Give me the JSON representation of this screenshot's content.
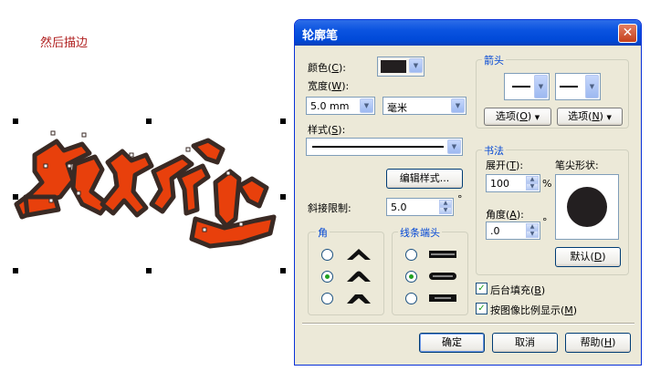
{
  "canvas": {
    "caption": "然后描边"
  },
  "dialog": {
    "title": "轮廓笔",
    "close_icon": "close-icon",
    "color": {
      "label_pre": "颜色(",
      "label_key": "C",
      "label_post": "):",
      "swatch": "#231f20"
    },
    "width": {
      "label_pre": "宽度(",
      "label_key": "W",
      "label_post": "):",
      "value": "5.0 mm",
      "unit": "毫米"
    },
    "style": {
      "label_pre": "样式(",
      "label_key": "S",
      "label_post": "):"
    },
    "edit_style_button": "编辑样式...",
    "miter": {
      "label": "斜接限制:",
      "value": "5.0",
      "unit": "°"
    },
    "corners": {
      "title": "角",
      "selected": 1
    },
    "linecaps": {
      "title": "线条端头",
      "selected": 1
    },
    "arrows": {
      "title": "箭头",
      "option_left": {
        "pre": "选项(",
        "key": "O",
        "post": ")"
      },
      "option_right": {
        "pre": "选项(",
        "key": "N",
        "post": ")"
      }
    },
    "calligraphy": {
      "title": "书法",
      "stretch": {
        "pre": "展开(",
        "key": "T",
        "post": "):",
        "value": "100",
        "unit": "%"
      },
      "angle": {
        "pre": "角度(",
        "key": "A",
        "post": "):",
        "value": ".0",
        "unit": "°"
      },
      "nib_label": "笔尖形状:",
      "default_button": {
        "pre": "默认(",
        "key": "D",
        "post": ")"
      }
    },
    "behind_fill": {
      "pre": "后台填充(",
      "key": "B",
      "post": ")",
      "checked": true
    },
    "scale_with_image": {
      "pre": "按图像比例显示(",
      "key": "M",
      "post": ")",
      "checked": true
    },
    "buttons": {
      "ok": "确定",
      "cancel": "取消",
      "help": {
        "pre": "帮助(",
        "key": "H",
        "post": ")"
      }
    }
  }
}
